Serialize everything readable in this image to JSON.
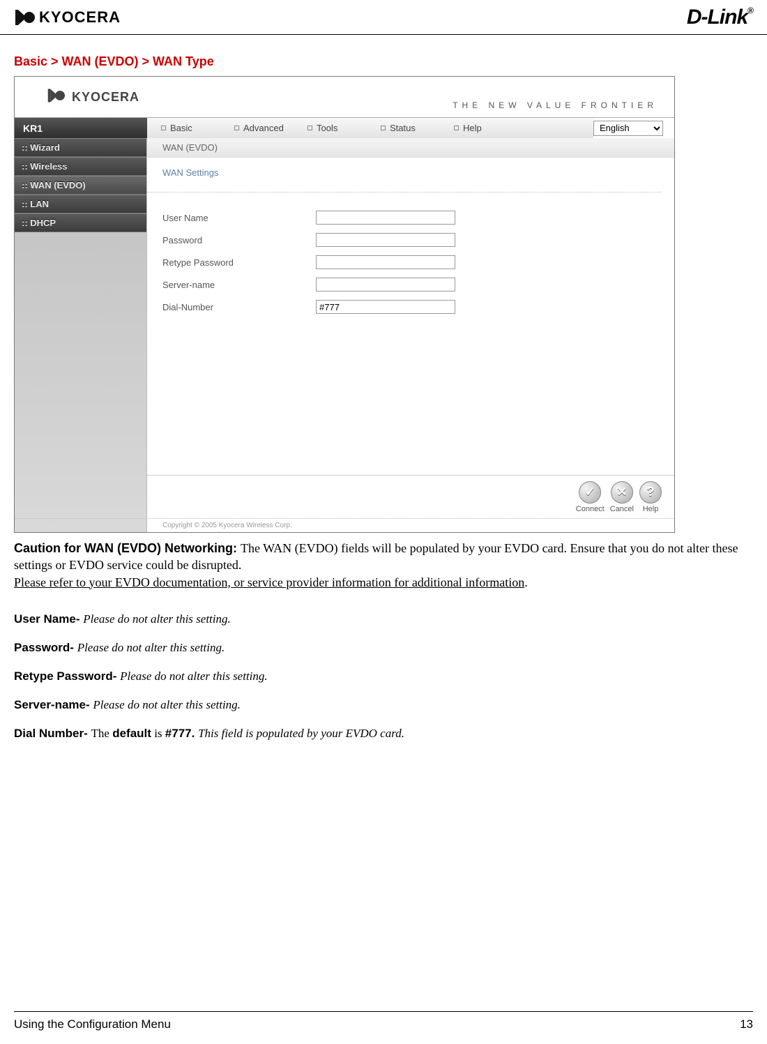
{
  "header": {
    "left_brand": "KYOCERA",
    "right_brand": "D-Link"
  },
  "breadcrumb": "Basic > WAN (EVDO) > WAN Type",
  "router": {
    "top_brand": "KYOCERA",
    "tagline": "THE NEW VALUE FRONTIER",
    "model": "KR1",
    "tabs": [
      "Basic",
      "Advanced",
      "Tools",
      "Status",
      "Help"
    ],
    "language": "English",
    "sidebar": [
      ":: Wizard",
      ":: Wireless",
      ":: WAN (EVDO)",
      ":: LAN",
      ":: DHCP"
    ],
    "sidebar_active_index": 2,
    "crumb": "WAN (EVDO)",
    "section_title": "WAN Settings",
    "fields": [
      {
        "label": "User Name",
        "value": ""
      },
      {
        "label": "Password",
        "value": ""
      },
      {
        "label": "Retype Password",
        "value": ""
      },
      {
        "label": "Server-name",
        "value": ""
      },
      {
        "label": "Dial-Number",
        "value": "#777"
      }
    ],
    "actions": [
      {
        "name": "Connect",
        "glyph": "✓"
      },
      {
        "name": "Cancel",
        "glyph": "✕"
      },
      {
        "name": "Help",
        "glyph": "?"
      }
    ],
    "copyright": "Copyright © 2005 Kyocera Wireless Corp."
  },
  "caution": {
    "lead_bold": "Caution for WAN (EVDO) Networking: ",
    "line1": "The WAN (EVDO) fields will be populated by your EVDO card. Ensure that you do not alter these settings or EVDO service could be disrupted.",
    "line2_underlined": "Please refer to your EVDO documentation, or service provider information for additional information",
    "line2_tail": "."
  },
  "field_desc": [
    {
      "name": "User Name- ",
      "rest_italic": "Please do not alter this setting."
    },
    {
      "name": "Password- ",
      "rest_italic": "Please do not alter this setting."
    },
    {
      "name": "Retype Password- ",
      "rest_italic": "Please do not alter this setting."
    },
    {
      "name": "Server-name- ",
      "rest_italic": "Please do not alter this setting."
    },
    {
      "name": "Dial Number- ",
      "pre": "The ",
      "bold1": "default",
      "mid": " is ",
      "bold2": "#777. ",
      "rest_italic": "This field is populated by your EVDO card."
    }
  ],
  "footer": {
    "left": "Using the Configuration Menu",
    "right": "13"
  }
}
